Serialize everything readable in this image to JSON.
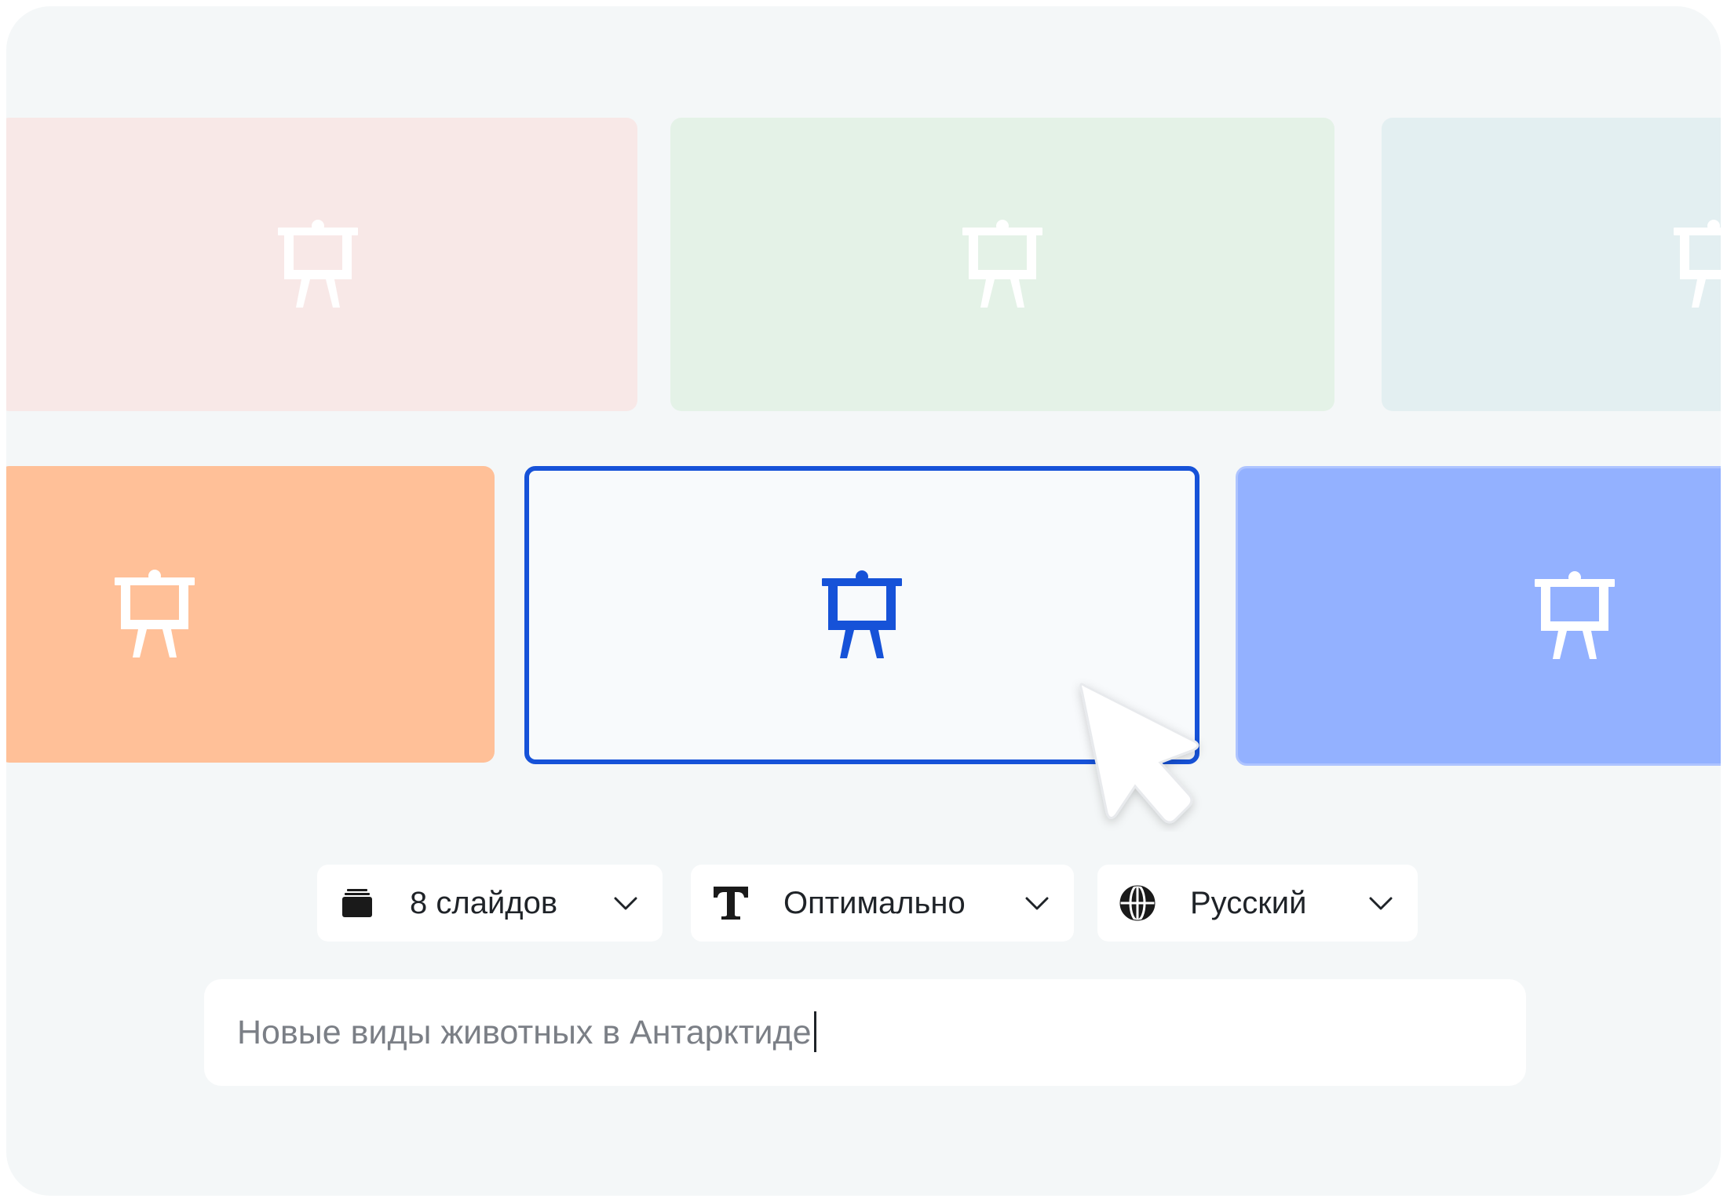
{
  "colors": {
    "background": "#f4f7f8",
    "card_pink": "#f8e8e7",
    "card_green": "#e4f2e7",
    "card_teal": "#e3eff1",
    "card_orange": "#ffc098",
    "card_selected": "#f8fafc",
    "card_blue": "#93b1ff",
    "accent": "#1652d8"
  },
  "slides": [
    {
      "row": 1,
      "color": "pink",
      "icon": "presentation-easel-icon",
      "selected": false
    },
    {
      "row": 1,
      "color": "green",
      "icon": "presentation-easel-icon",
      "selected": false
    },
    {
      "row": 1,
      "color": "teal",
      "icon": "presentation-easel-icon",
      "selected": false
    },
    {
      "row": 2,
      "color": "orange",
      "icon": "presentation-easel-icon",
      "selected": false
    },
    {
      "row": 2,
      "color": "white",
      "icon": "presentation-easel-icon",
      "selected": true
    },
    {
      "row": 2,
      "color": "blue",
      "icon": "presentation-easel-icon",
      "selected": false
    }
  ],
  "controls": {
    "slides_count": {
      "label": "8 слайдов",
      "icon": "slides-stack-icon"
    },
    "text_amount": {
      "label": "Оптимально",
      "icon": "text-type-icon"
    },
    "language": {
      "label": "Русский",
      "icon": "globe-icon"
    }
  },
  "prompt": {
    "value": "Новые виды животных в Антарктиде"
  }
}
